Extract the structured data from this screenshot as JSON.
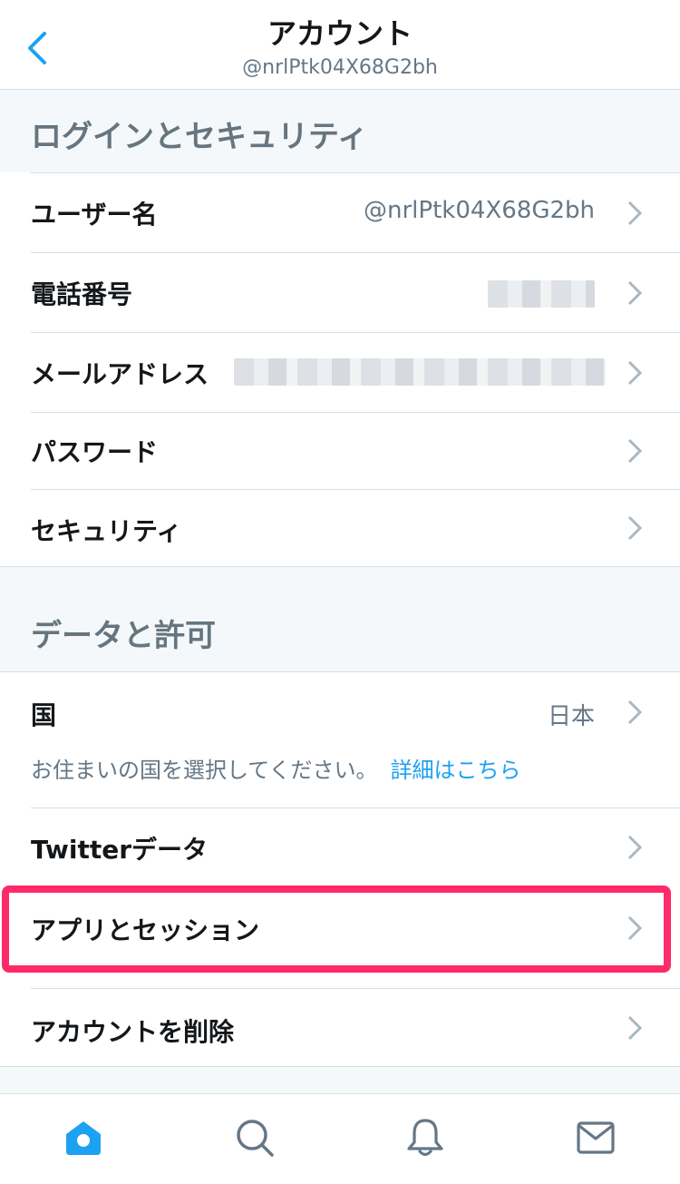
{
  "header": {
    "title": "アカウント",
    "handle": "@nrlPtk04X68G2bh"
  },
  "sections": {
    "login_security": {
      "title": "ログインとセキュリティ",
      "username_label": "ユーザー名",
      "username_value": "@nrlPtk04X68G2bh",
      "phone_label": "電話番号",
      "email_label": "メールアドレス",
      "password_label": "パスワード",
      "security_label": "セキュリティ"
    },
    "data_permissions": {
      "title": "データと許可",
      "country_label": "国",
      "country_value": "日本",
      "country_note": "お住まいの国を選択してください。",
      "country_link": "詳細はこちら",
      "twitter_data_label": "Twitterデータ",
      "apps_sessions_label": "アプリとセッション",
      "delete_account_label": "アカウントを削除"
    }
  },
  "tabbar": [
    "home-icon",
    "search-icon",
    "bell-icon",
    "mail-icon"
  ],
  "colors": {
    "accent": "#1da1f2",
    "highlight": "#ff2a68",
    "section_bg": "#f5f8fa",
    "secondary_text": "#657786"
  }
}
